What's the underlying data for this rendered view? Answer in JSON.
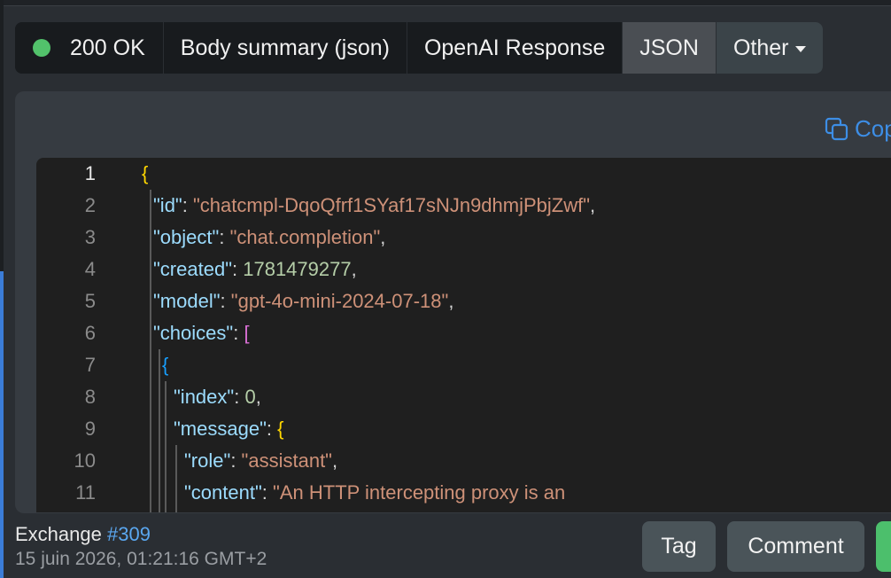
{
  "tabs": {
    "status": "200 OK",
    "status_color": "#52c26b",
    "body_summary": "Body summary (json)",
    "openai": "OpenAI Response",
    "json": "JSON",
    "other": "Other"
  },
  "copy_label": "Cop",
  "code": {
    "lines": [
      {
        "n": "1"
      },
      {
        "n": "2"
      },
      {
        "n": "3"
      },
      {
        "n": "4"
      },
      {
        "n": "5"
      },
      {
        "n": "6"
      },
      {
        "n": "7"
      },
      {
        "n": "8"
      },
      {
        "n": "9"
      },
      {
        "n": "10"
      },
      {
        "n": "11"
      }
    ],
    "tokens": {
      "open_brace": "{",
      "id_key": "\"id\"",
      "id_val": "\"chatcmpl-DqoQfrf1SYaf17sNJn9dhmjPbjZwf\"",
      "object_key": "\"object\"",
      "object_val": "\"chat.completion\"",
      "created_key": "\"created\"",
      "created_val": "1781479277",
      "model_key": "\"model\"",
      "model_val": "\"gpt-4o-mini-2024-07-18\"",
      "choices_key": "\"choices\"",
      "choices_bracket": "[",
      "choice_brace": "{",
      "index_key": "\"index\"",
      "index_val": "0",
      "message_key": "\"message\"",
      "message_brace": "{",
      "role_key": "\"role\"",
      "role_val": "\"assistant\"",
      "content_key": "\"content\"",
      "content_val": "\"An HTTP intercepting proxy is an",
      "colon": ": ",
      "comma": ","
    }
  },
  "footer": {
    "exchange_label": "Exchange",
    "exchange_number": "#309",
    "date": "15 juin 2026, 01:21:16 GMT+2",
    "tag_button": "Tag",
    "comment_button": "Comment"
  }
}
